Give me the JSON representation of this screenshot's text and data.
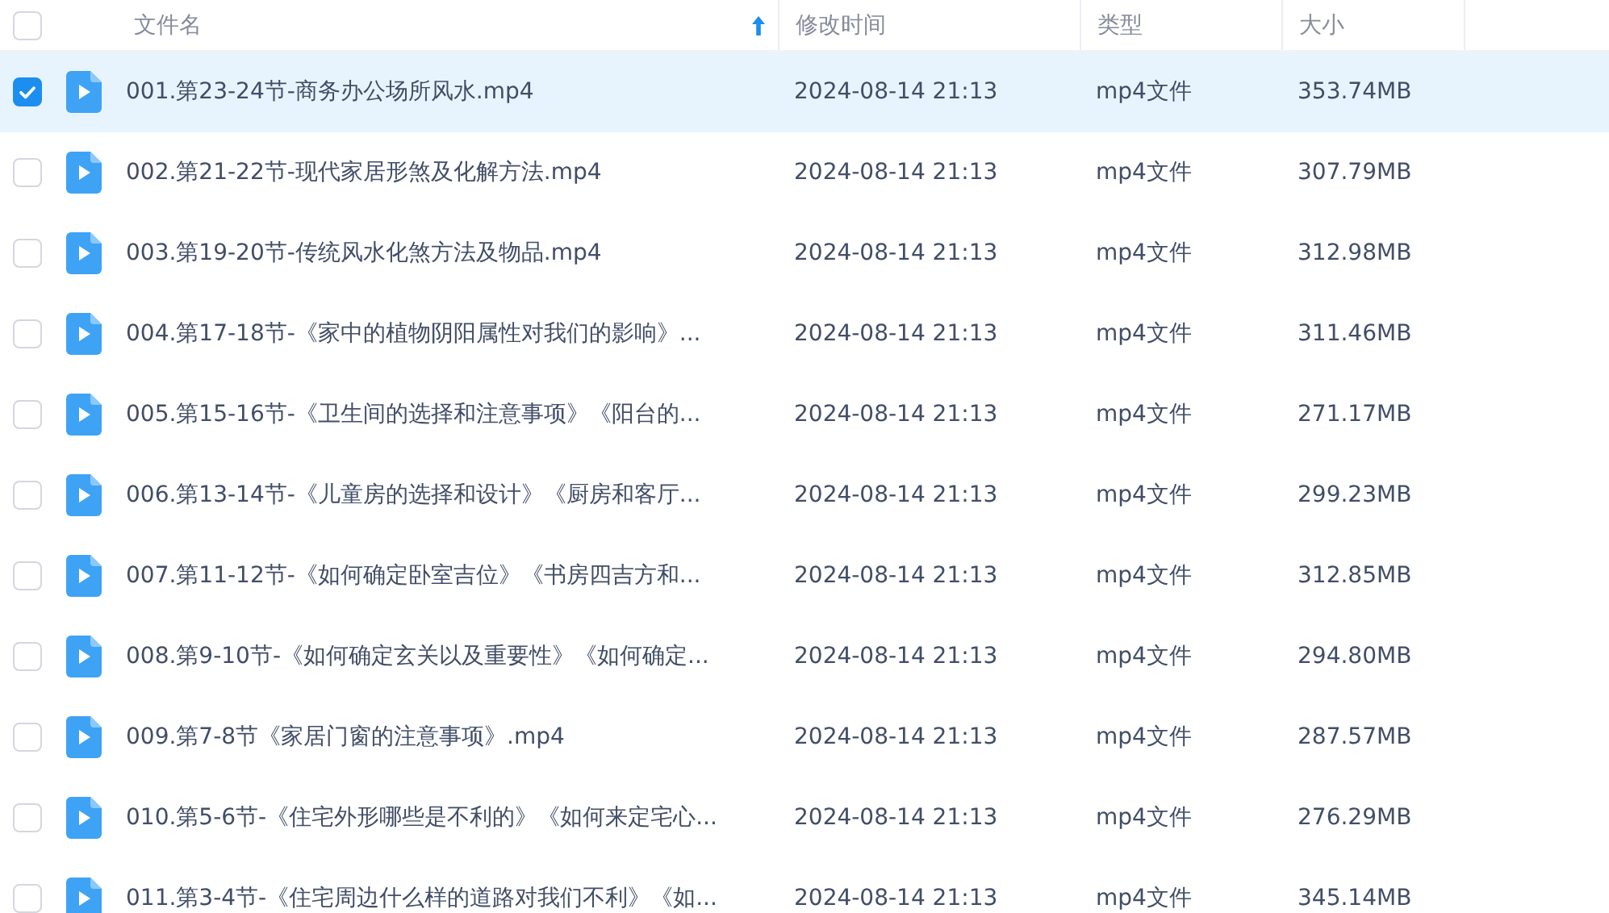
{
  "table": {
    "select_all_checked": false,
    "columns": [
      {
        "label": "文件名",
        "sorted": true
      },
      {
        "label": "修改时间",
        "sorted": false
      },
      {
        "label": "类型",
        "sorted": false
      },
      {
        "label": "大小",
        "sorted": false
      }
    ],
    "rows": [
      {
        "name": "001.第23-24节-商务办公场所风水.mp4",
        "modified": "2024-08-14 21:13",
        "type": "mp4文件",
        "size": "353.74MB",
        "selected": true
      },
      {
        "name": "002.第21-22节-现代家居形煞及化解方法.mp4",
        "modified": "2024-08-14 21:13",
        "type": "mp4文件",
        "size": "307.79MB",
        "selected": false
      },
      {
        "name": "003.第19-20节-传统风水化煞方法及物品.mp4",
        "modified": "2024-08-14 21:13",
        "type": "mp4文件",
        "size": "312.98MB",
        "selected": false
      },
      {
        "name": "004.第17-18节-《家中的植物阴阳属性对我们的影响》...",
        "modified": "2024-08-14 21:13",
        "type": "mp4文件",
        "size": "311.46MB",
        "selected": false
      },
      {
        "name": "005.第15-16节-《卫生间的选择和注意事项》《阳台的...",
        "modified": "2024-08-14 21:13",
        "type": "mp4文件",
        "size": "271.17MB",
        "selected": false
      },
      {
        "name": "006.第13-14节-《儿童房的选择和设计》《厨房和客厅...",
        "modified": "2024-08-14 21:13",
        "type": "mp4文件",
        "size": "299.23MB",
        "selected": false
      },
      {
        "name": "007.第11-12节-《如何确定卧室吉位》《书房四吉方和...",
        "modified": "2024-08-14 21:13",
        "type": "mp4文件",
        "size": "312.85MB",
        "selected": false
      },
      {
        "name": "008.第9-10节-《如何确定玄关以及重要性》《如何确定...",
        "modified": "2024-08-14 21:13",
        "type": "mp4文件",
        "size": "294.80MB",
        "selected": false
      },
      {
        "name": "009.第7-8节《家居门窗的注意事项》.mp4",
        "modified": "2024-08-14 21:13",
        "type": "mp4文件",
        "size": "287.57MB",
        "selected": false
      },
      {
        "name": "010.第5-6节-《住宅外形哪些是不利的》《如何来定宅心...",
        "modified": "2024-08-14 21:13",
        "type": "mp4文件",
        "size": "276.29MB",
        "selected": false
      },
      {
        "name": "011.第3-4节-《住宅周边什么样的道路对我们不利》《如...",
        "modified": "2024-08-14 21:13",
        "type": "mp4文件",
        "size": "345.14MB",
        "selected": false
      }
    ]
  }
}
